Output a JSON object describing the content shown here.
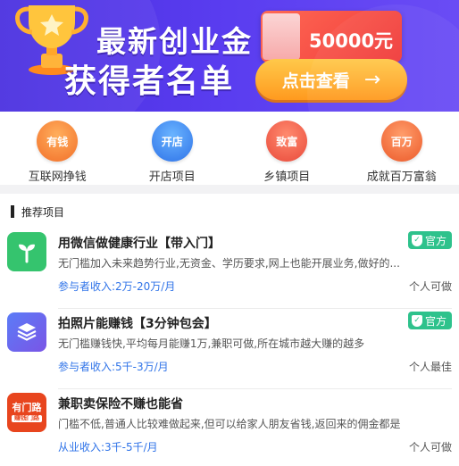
{
  "banner": {
    "title_line1": "最新创业金",
    "title_line2": "获得者名单",
    "cash_amount": "50000元",
    "check_button": "点击查看",
    "arrow": "→"
  },
  "categories": [
    {
      "icon_text": "有钱",
      "label": "互联网挣钱",
      "icon": "money-bag-icon"
    },
    {
      "icon_text": "开店",
      "label": "开店项目",
      "icon": "shop-icon"
    },
    {
      "icon_text": "致富",
      "label": "乡镇项目",
      "icon": "pig-icon"
    },
    {
      "icon_text": "百万",
      "label": "成就百万富翁",
      "icon": "gold-bar-icon"
    }
  ],
  "section": {
    "title": "推荐项目"
  },
  "items": [
    {
      "title": "用微信做健康行业【带入门】",
      "badge": "官方",
      "desc": "无门槛加入未来趋势行业,无资金、学历要求,网上也能开展业务,做好的...",
      "income": "参与者收入:2万-20万/月",
      "note": "个人可做"
    },
    {
      "title": "拍照片能赚钱【3分钟包会】",
      "badge": "官方",
      "desc": "无门槛赚钱快,平均每月能赚1万,兼职可做,所在城市越大赚的越多",
      "income": "参与者收入:5千-3万/月",
      "note": "个人最佳"
    },
    {
      "title": "兼职卖保险不赚也能省",
      "desc": "门槛不低,普通人比较难做起来,但可以给家人朋友省钱,返回来的佣金都是",
      "income": "从业收入:3千-5千/月",
      "note": "个人可做",
      "logo_text": "有门路",
      "logo_sub": "赚钱门路"
    }
  ],
  "colors": {
    "banner": "#5a3df0",
    "accent_blue": "#2f73e8",
    "official_green": "#2ec28c",
    "button_orange": "#ff9a1f"
  }
}
